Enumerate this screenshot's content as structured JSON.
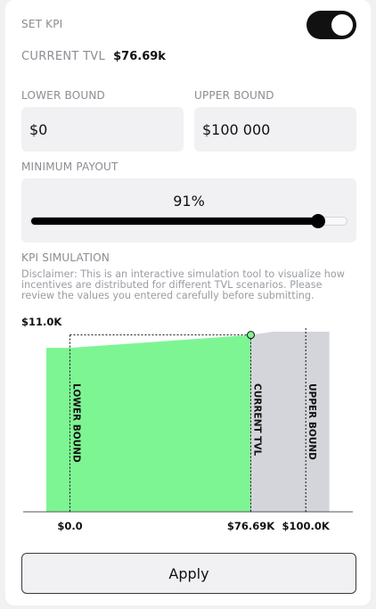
{
  "header": {
    "set_kpi_label": "SET KPI",
    "toggle_on": true
  },
  "tvl": {
    "label": "CURRENT TVL",
    "value": "$76.69k"
  },
  "bounds": {
    "lower_label": "LOWER BOUND",
    "lower_value": "$0",
    "upper_label": "UPPER BOUND",
    "upper_value": "$100 000"
  },
  "payout": {
    "label": "MINIMUM PAYOUT",
    "value_text": "91%",
    "fraction": 0.91
  },
  "simulation": {
    "label": "KPI SIMULATION",
    "disclaimer": "Disclaimer: This is an interactive simulation tool to visualize how incentives are distributed for different TVL scenarios. Please review the values you entered carefully before submitting."
  },
  "chart_data": {
    "type": "area",
    "y_top_label": "$11.0K",
    "y_max": 11000,
    "x_max": 110000,
    "x_ticks": [
      {
        "x": 0,
        "label": "$0.0"
      },
      {
        "x": 76690,
        "label": "$76.69K"
      },
      {
        "x": 100000,
        "label": "$100.0K"
      }
    ],
    "series": [
      {
        "x": [
          -10000,
          0,
          76690
        ],
        "y": [
          10010,
          10010,
          10800
        ],
        "color": "#7ef593"
      },
      {
        "x": [
          76690,
          86000,
          110000
        ],
        "y": [
          10800,
          11000,
          11000
        ],
        "color": "#d4d5da"
      }
    ],
    "markers": [
      {
        "x": 0,
        "label": "LOWER BOUND"
      },
      {
        "x": 76690,
        "label": "CURRENT TVL"
      },
      {
        "x": 100000,
        "label": "UPPER BOUND"
      }
    ],
    "current_point": {
      "x": 76690,
      "y": 10800
    }
  },
  "apply_label": "Apply"
}
